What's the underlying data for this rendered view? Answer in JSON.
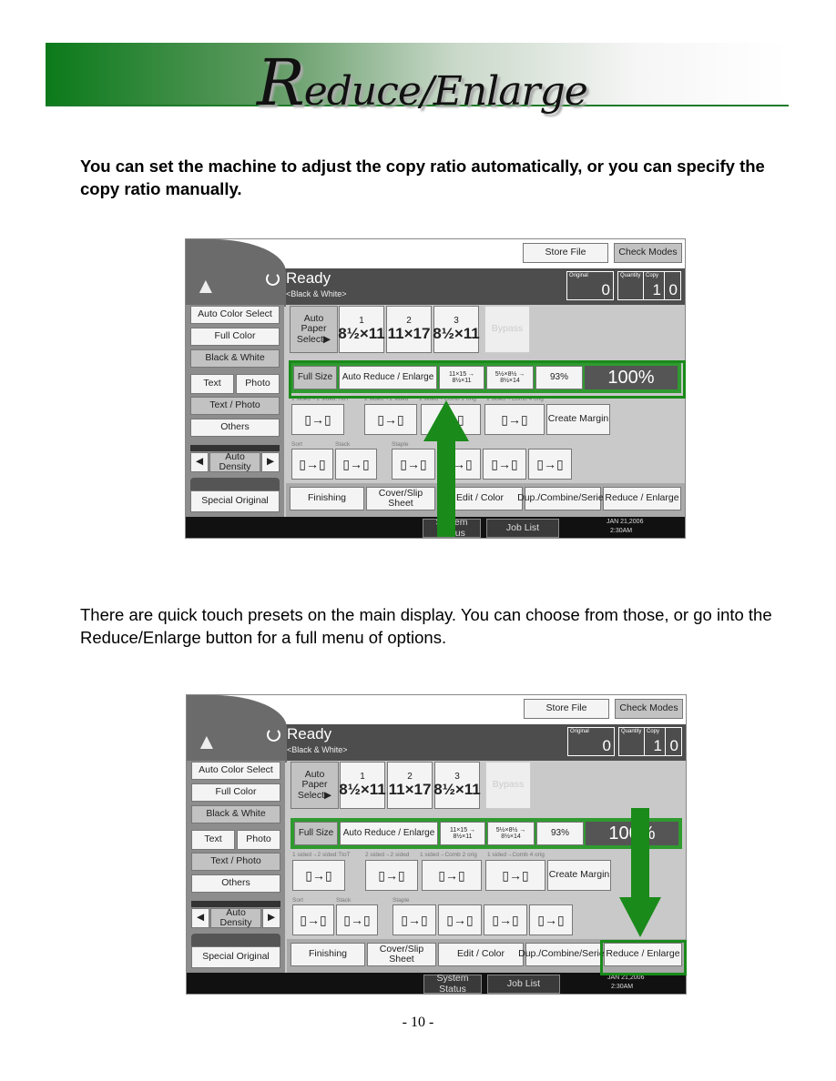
{
  "page": {
    "title_initial": "R",
    "title_rest": "educe/Enlarge",
    "intro": "You can set the machine to adjust the copy ratio automatically, or you can specify the copy ratio manually.",
    "presets_text": "There are quick touch presets on the main display.  You can choose from those, or go into the Reduce/Enlarge button for a full menu of options.",
    "page_number": "- 10 -",
    "accent_color": "#1a8a1a"
  },
  "copier_panel": {
    "store_file": "Store File",
    "check_modes": "Check Modes",
    "status": "Ready",
    "mode": "<Black & White>",
    "counters": [
      {
        "label": "Original",
        "value": "0"
      },
      {
        "label": "Quantity",
        "value": "1"
      },
      {
        "label": "Copy",
        "value": "0"
      }
    ],
    "color_buttons": [
      "Auto Color Select",
      "Full Color",
      "Black & White"
    ],
    "text": "Text",
    "photo": "Photo",
    "text_photo": "Text / Photo",
    "others": "Others",
    "auto_density": "Auto Density",
    "special_original": "Special Original",
    "auto_paper": "Auto Paper Select▶",
    "trays": [
      {
        "num": "1",
        "size": "8½×11"
      },
      {
        "num": "2",
        "size": "11×17"
      },
      {
        "num": "3",
        "size": "8½×11"
      }
    ],
    "bypass": "Bypass",
    "ratios": [
      "Full Size",
      "Auto Reduce / Enlarge",
      "11×15 → 8½×11",
      "5½×8½ → 8½×14",
      "93%"
    ],
    "ratio_value": "100%",
    "duplex_labels": [
      "1 sided→2 sided:TtoT",
      "2 sided→2 sided",
      "1 sided→Comb 2 orig",
      "1 sided→Comb 4 orig"
    ],
    "create_margin": "Create Margin",
    "finish_labels": [
      "Sort",
      "Stack",
      "Staple"
    ],
    "tabs": [
      "Finishing",
      "Cover/Slip Sheet",
      "Edit / Color",
      "Dup./Combine/Series",
      "Reduce / Enlarge"
    ],
    "system_status": "System Status",
    "job_list": "Job List",
    "date": "JAN  21,2006",
    "time": "2:30AM"
  }
}
